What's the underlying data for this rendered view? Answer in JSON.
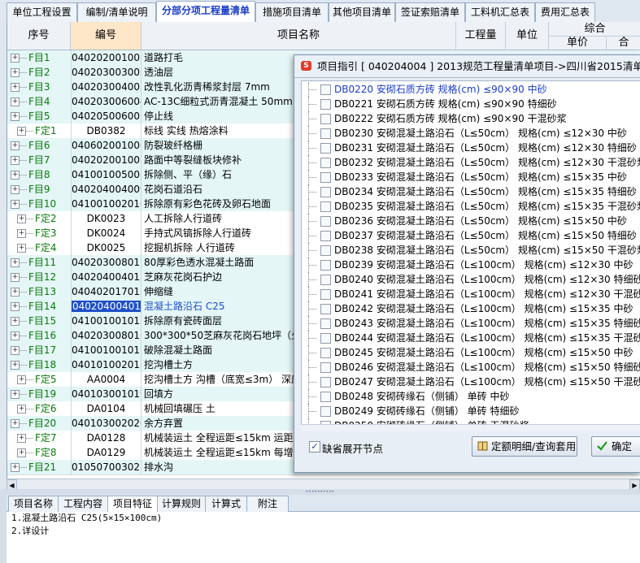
{
  "top_tabs": [
    "单位工程设置",
    "编制/清单说明",
    "分部分项工程量清单",
    "措施项目清单",
    "其他项目清单",
    "签证索赔清单",
    "工料机汇总表",
    "费用汇总表"
  ],
  "active_top_tab": "分部分项工程量清单",
  "grid": {
    "headers": {
      "seq": "序号",
      "code": "编号",
      "name": "项目名称",
      "qty": "工程量",
      "unit": "单位",
      "group": "综合",
      "price": "单价",
      "total": "合"
    },
    "rows": [
      {
        "seq": "F目1",
        "code": "040202001001",
        "name": "道路打毛",
        "type": "qd"
      },
      {
        "seq": "F目2",
        "code": "040203003002",
        "name": "透油层",
        "type": "qd"
      },
      {
        "seq": "F目3",
        "code": "040203004003",
        "name": "改性乳化沥青稀浆封层 7mm",
        "type": "qd"
      },
      {
        "seq": "F目4",
        "code": "040203006004",
        "name": "AC-13C细粒式沥青混凝土 50mm",
        "type": "qd"
      },
      {
        "seq": "F目5",
        "code": "040205006005",
        "name": "停止线",
        "type": "qd"
      },
      {
        "seq": "F定1",
        "code": "DB0382",
        "name": "标线 实线 热熔涂料",
        "type": "de"
      },
      {
        "seq": "F目6",
        "code": "040602001006",
        "name": "防裂玻纤格栅",
        "type": "qd"
      },
      {
        "seq": "F目7",
        "code": "040202001007",
        "name": "路面中等裂缝板块修补",
        "type": "qd"
      },
      {
        "seq": "F目8",
        "code": "041001005008",
        "name": "拆除侧、平（缘）石",
        "type": "qd"
      },
      {
        "seq": "F目9",
        "code": "040204004009",
        "name": "花岗石道沿石",
        "type": "qd"
      },
      {
        "seq": "F目10",
        "code": "041001002010",
        "name": "拆除原有彩色花砖及卵石地面",
        "type": "qd"
      },
      {
        "seq": "F定2",
        "code": "DK0023",
        "name": "人工拆除人行道砖",
        "type": "de"
      },
      {
        "seq": "F定3",
        "code": "DK0024",
        "name": "手持式风镐拆除人行道砖",
        "type": "de"
      },
      {
        "seq": "F定4",
        "code": "DK0025",
        "name": "挖掘机拆除 人行道砖",
        "type": "de"
      },
      {
        "seq": "F目11",
        "code": "040203008011",
        "name": "80厚彩色透水混凝土路面",
        "type": "qd"
      },
      {
        "seq": "F目12",
        "code": "040204004012",
        "name": "芝麻灰花岗石护边",
        "type": "qd"
      },
      {
        "seq": "F目13",
        "code": "040402017013",
        "name": "伸缩缝",
        "type": "qd"
      },
      {
        "seq": "F目14",
        "code": "040204004014",
        "name": "混凝土路沿石 C25",
        "type": "qd",
        "selected": true
      },
      {
        "seq": "F目15",
        "code": "041001001015",
        "name": "拆除原有瓷砖面层",
        "type": "qd"
      },
      {
        "seq": "F目16",
        "code": "040203008016",
        "name": "300*300*50芝麻灰花岗石地坪（火烧",
        "type": "qd"
      },
      {
        "seq": "F目17",
        "code": "041001001017",
        "name": "破除混凝土路面",
        "type": "qd"
      },
      {
        "seq": "F目18",
        "code": "040101002018",
        "name": "挖沟槽土方",
        "type": "qd"
      },
      {
        "seq": "F定5",
        "code": "AA0004",
        "name": "挖沟槽土方 沟槽（底宽≤3m） 深度",
        "type": "de"
      },
      {
        "seq": "F目19",
        "code": "040103001019",
        "name": "回填方",
        "type": "qd"
      },
      {
        "seq": "F定6",
        "code": "DA0104",
        "name": "机械回填碾压 土",
        "type": "de"
      },
      {
        "seq": "F目20",
        "code": "040103002020",
        "name": "余方弃置",
        "type": "qd"
      },
      {
        "seq": "F定7",
        "code": "DA0128",
        "name": "机械装运土 全程运距≤15km 运距",
        "type": "de"
      },
      {
        "seq": "F定8",
        "code": "DA0129",
        "name": "机械装运土 全程运距≤15km 每增加",
        "type": "de"
      },
      {
        "seq": "F目21",
        "code": "010507003021",
        "name": "排水沟",
        "type": "qd"
      }
    ]
  },
  "bottom_tabs": [
    "项目名称",
    "工程内容",
    "项目特征",
    "计算规则",
    "计算式",
    "附注"
  ],
  "active_bottom_tab": "项目特征",
  "bottom_text": [
    "1.混凝土路沿石 C25(5×15×100cm)",
    "2.详设计"
  ],
  "dialog": {
    "title": "项目指引 [ 040204004 ] 2013规范工程量清单项目->四川省2015清单定额",
    "items": [
      "DB0220 安砌石质方砖 规格(cm) ≤90×90 中砂",
      "DB0221 安砌石质方砖 规格(cm) ≤90×90 特细砂",
      "DB0222 安砌石质方砖 规格(cm) ≤90×90 干混砂浆",
      "DB0230 安砌混凝土路沿石（L≤50cm） 规格(cm) ≤12×30 中砂",
      "DB0231 安砌混凝土路沿石（L≤50cm） 规格(cm) ≤12×30 特细砂",
      "DB0232 安砌混凝土路沿石（L≤50cm） 规格(cm) ≤12×30 干混砂浆",
      "DB0233 安砌混凝土路沿石（L≤50cm） 规格(cm) ≤15×35 中砂",
      "DB0234 安砌混凝土路沿石（L≤50cm） 规格(cm) ≤15×35 特细砂",
      "DB0235 安砌混凝土路沿石（L≤50cm） 规格(cm) ≤15×35 干混砂浆",
      "DB0236 安砌混凝土路沿石（L≤50cm） 规格(cm) ≤15×50 中砂",
      "DB0237 安砌混凝土路沿石（L≤50cm） 规格(cm) ≤15×50 特细砂",
      "DB0238 安砌混凝土路沿石（L≤50cm） 规格(cm) ≤15×50 干混砂浆",
      "DB0239 安砌混凝土路沿石（L≤100cm） 规格(cm) ≤12×30 中砂",
      "DB0240 安砌混凝土路沿石（L≤100cm） 规格(cm) ≤12×30 特细砂",
      "DB0241 安砌混凝土路沿石（L≤100cm） 规格(cm) ≤12×30 干混砂浆",
      "DB0242 安砌混凝土路沿石（L≤100cm） 规格(cm) ≤15×35 中砂",
      "DB0243 安砌混凝土路沿石（L≤100cm） 规格(cm) ≤15×35 特细砂",
      "DB0244 安砌混凝土路沿石（L≤100cm） 规格(cm) ≤15×35 干混砂浆",
      "DB0245 安砌混凝土路沿石（L≤100cm） 规格(cm) ≤15×50 中砂",
      "DB0246 安砌混凝土路沿石（L≤100cm） 规格(cm) ≤15×50 特细砂",
      "DB0247 安砌混凝土路沿石（L≤100cm） 规格(cm) ≤15×50 干混砂浆",
      "DB0248 安砌砖缘石（侧铺） 单砖 中砂",
      "DB0249 安砌砖缘石（侧铺） 单砖 特细砂",
      "DB0250 安砌砖缘石（侧铺） 单砖 干混砂浆"
    ],
    "highlighted_index": 0,
    "default_expand_label": "缺省展开节点",
    "default_expand_checked": true,
    "detail_button": "定额明细/查询套用",
    "ok_button": "确定"
  },
  "colors": {
    "accent": "#1a3cc8",
    "selected_code_bg": "#1e50c8",
    "list_row_bg": "#e4f6f6",
    "header_selected_bg": "#fde7c8"
  }
}
